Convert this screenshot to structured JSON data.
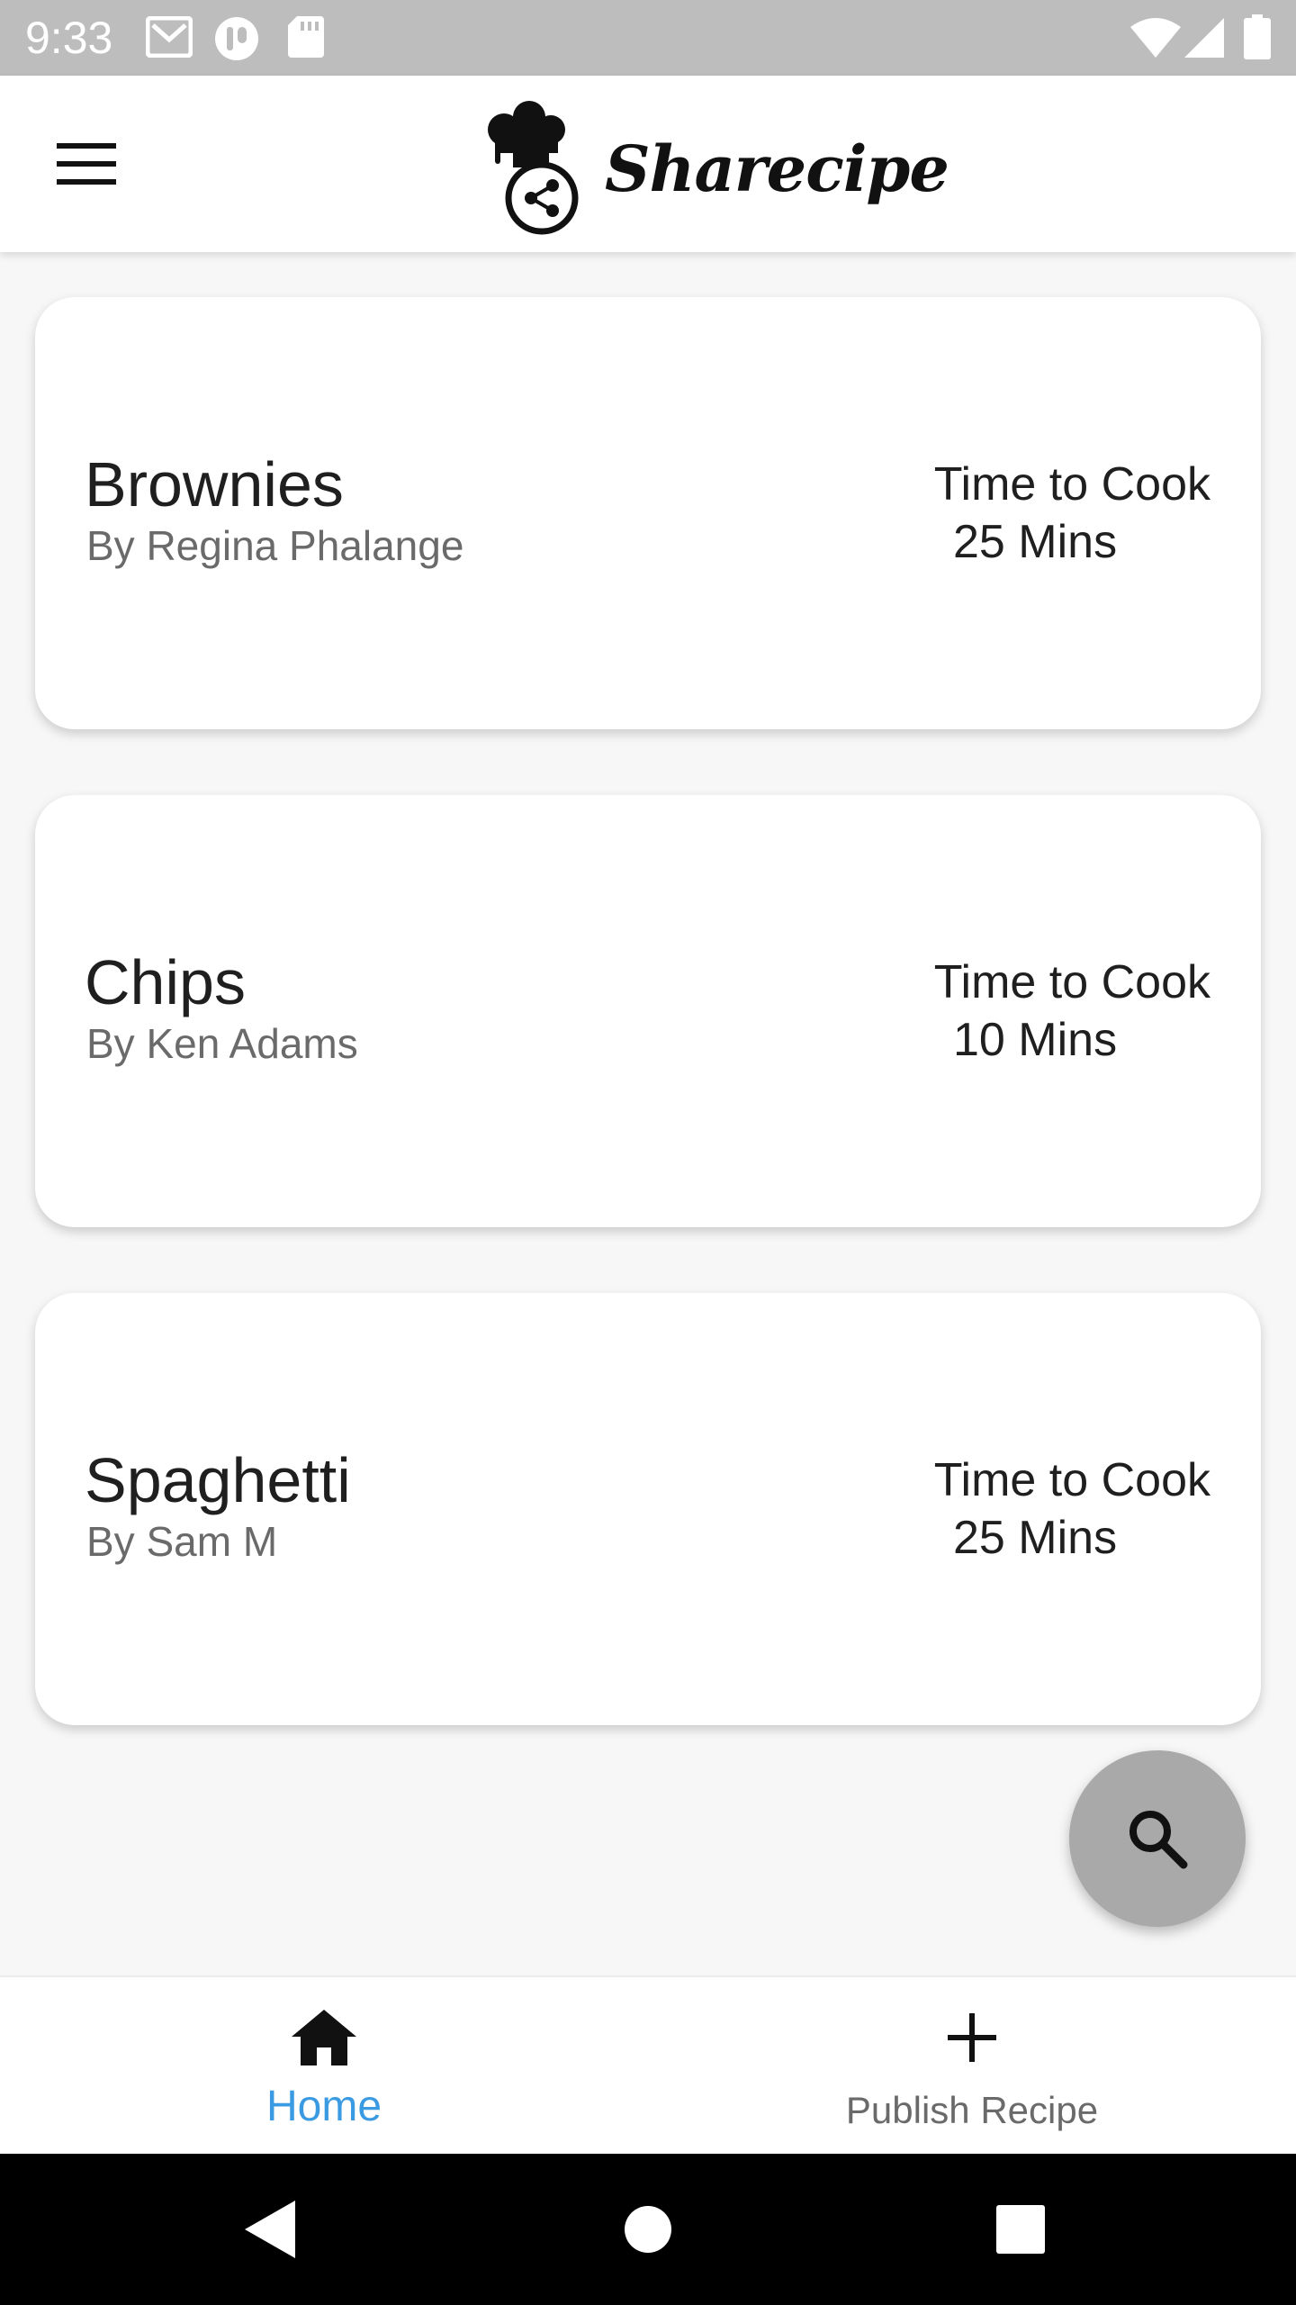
{
  "status_bar": {
    "time": "9:33",
    "icons": [
      "gmail-icon",
      "app-notification-icon",
      "sd-card-icon",
      "wifi-icon",
      "signal-icon",
      "battery-icon"
    ]
  },
  "app_bar": {
    "logo_text": "Sharecipe",
    "menu_icon": "menu-icon"
  },
  "recipes": [
    {
      "title": "Brownies",
      "author": "By Regina Phalange",
      "time_label": "Time to Cook",
      "time_value": "25 Mins"
    },
    {
      "title": "Chips",
      "author": "By Ken Adams",
      "time_label": "Time to Cook",
      "time_value": "10 Mins"
    },
    {
      "title": "Spaghetti",
      "author": "By Sam M",
      "time_label": "Time to Cook",
      "time_value": "25 Mins"
    }
  ],
  "fab": {
    "icon": "search-icon"
  },
  "bottom_nav": {
    "items": [
      {
        "label": "Home",
        "icon": "home-icon",
        "active": true
      },
      {
        "label": "Publish Recipe",
        "icon": "plus-icon",
        "active": false
      }
    ]
  },
  "colors": {
    "accent": "#3a9be3",
    "status_bar": "#bdbdbd",
    "fab": "#a9a9a9",
    "background": "#f7f7f7"
  }
}
